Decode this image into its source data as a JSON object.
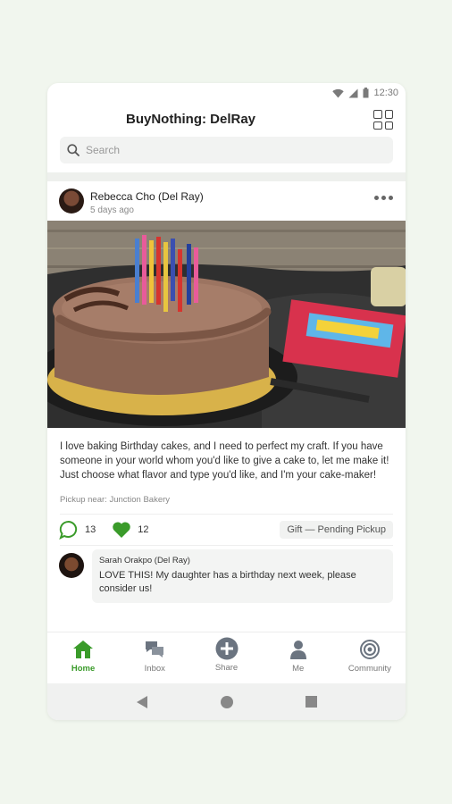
{
  "statusbar": {
    "time": "12:30"
  },
  "header": {
    "title": "BuyNothing: DelRay",
    "grid_icon": "grid-icon"
  },
  "search": {
    "placeholder": "Search"
  },
  "post": {
    "author": "Rebecca Cho (Del Ray)",
    "time_ago": "5 days ago",
    "body": "I love baking Birthday cakes, and I need to perfect my craft. If you have someone in your world whom you'd like to give a cake to, let me make it! Just choose what flavor and type you'd like, and I'm your cake-maker!",
    "pickup": "Pickup near: Junction Bakery",
    "comments_count": "13",
    "likes_count": "12",
    "status": "Gift — Pending Pickup"
  },
  "comment": {
    "author": "Sarah Orakpo (Del Ray)",
    "text": "LOVE THIS! My daughter has a birthday next week, please consider us!"
  },
  "nav": {
    "items": [
      {
        "label": "Home",
        "icon": "home-icon"
      },
      {
        "label": "Inbox",
        "icon": "inbox-icon"
      },
      {
        "label": "Share",
        "icon": "plus-circle-icon"
      },
      {
        "label": "Me",
        "icon": "person-icon"
      },
      {
        "label": "Community",
        "icon": "community-icon"
      }
    ]
  },
  "colors": {
    "accent": "#3a9b2a",
    "background": "#f1f6ee"
  }
}
